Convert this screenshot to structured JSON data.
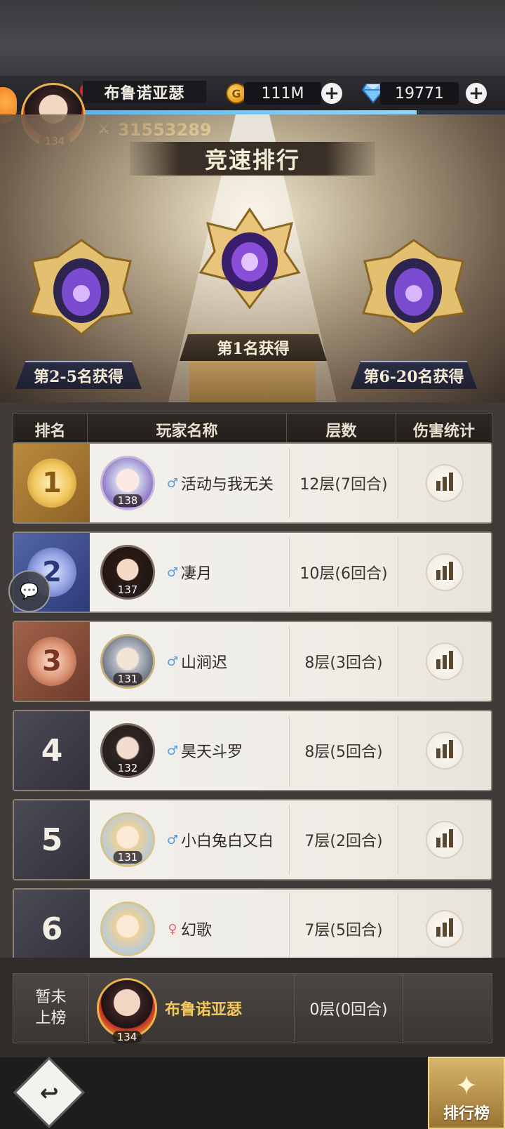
{
  "header": {
    "player_name": "布鲁诺亚瑟",
    "level": "134",
    "alert_badge": "!",
    "gold": "111M",
    "diamonds": "19771",
    "power": "31553289",
    "plus": "+"
  },
  "banner": {
    "title": "竞速排行",
    "reward_first": "第1名获得",
    "reward_2_5": "第2-5名获得",
    "reward_6_20": "第6-20名获得"
  },
  "table": {
    "headers": {
      "rank": "排名",
      "player": "玩家名称",
      "floors": "层数",
      "damage": "伤害统计"
    },
    "rows": [
      {
        "rank": "1",
        "level": "138",
        "gender": "male",
        "name": "活动与我无关",
        "floors": "12层(7回合)"
      },
      {
        "rank": "2",
        "level": "137",
        "gender": "male",
        "name": "凄月",
        "floors": "10层(6回合)"
      },
      {
        "rank": "3",
        "level": "131",
        "gender": "male",
        "name": "山涧迟",
        "floors": "8层(3回合)"
      },
      {
        "rank": "4",
        "level": "132",
        "gender": "male",
        "name": "昊天斗罗",
        "floors": "8层(5回合)"
      },
      {
        "rank": "5",
        "level": "131",
        "gender": "male",
        "name": "小白兔白又白",
        "floors": "7层(2回合)"
      },
      {
        "rank": "6",
        "level": "",
        "gender": "female",
        "name": "幻歌",
        "floors": "7层(5回合)"
      }
    ]
  },
  "self_row": {
    "rank_line1": "暂未",
    "rank_line2": "上榜",
    "level": "134",
    "name": "布鲁诺亚瑟",
    "floors": "0层(0回合)"
  },
  "footer": {
    "back_icon": "↩",
    "leaderboard_label": "排行榜"
  },
  "icons": {
    "gold": "coin-icon",
    "diamond": "diamond-icon",
    "chart": "bar-chart-icon",
    "chat": "chat-bubble-icon"
  },
  "colors": {
    "gold_text": "#f2c75b",
    "rank1": "#b98a3e",
    "rank2": "#5466a8",
    "rank3": "#a0624a",
    "rank_other": "#4b4a55",
    "male": "#5a9ad8",
    "female": "#e06a6a"
  }
}
